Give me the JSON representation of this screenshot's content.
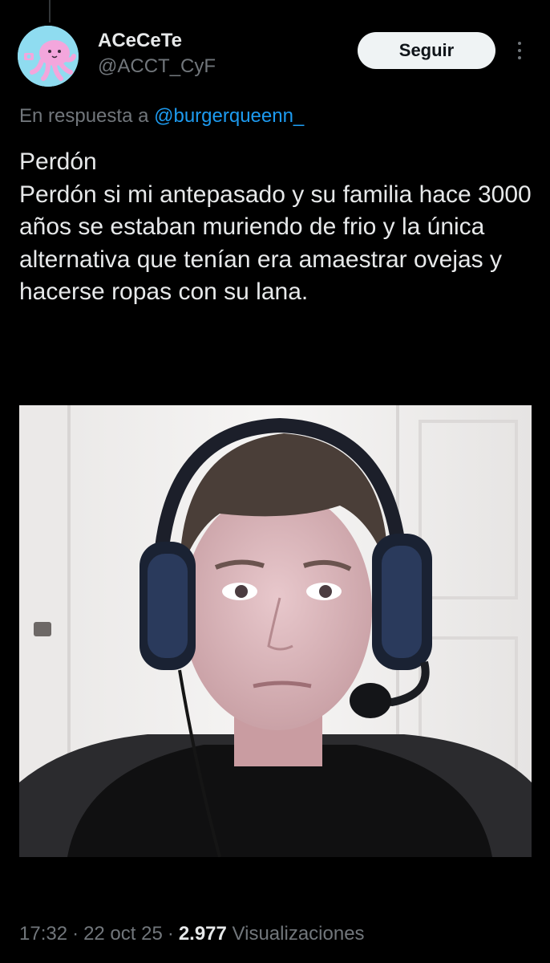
{
  "tweet": {
    "author": {
      "display_name": "ACeCeTe",
      "handle": "@ACCT_CyF",
      "avatar_icon": "pink-octopus-avatar"
    },
    "follow_label": "Seguir",
    "more_icon": "more-vertical-icon",
    "reply_prefix": "En respuesta a",
    "reply_mention": "@burgerqueenn_",
    "text_lines": [
      "Perdón",
      "Perdón si mi antepasado y su familia hace 3000 años se estaban muriendo de frio y la única alternativa que tenían era amaestrar ovejas y hacerse ropas con su lana."
    ],
    "time": "17:32",
    "date": "22 oct 25",
    "views_count": "2.977",
    "views_label": "Visualizaciones",
    "separator": "·"
  },
  "colors": {
    "background": "#000000",
    "text_primary": "#e7e9ea",
    "text_secondary": "#71767b",
    "link": "#1d9bf0",
    "follow_button_bg": "#eff3f4"
  }
}
